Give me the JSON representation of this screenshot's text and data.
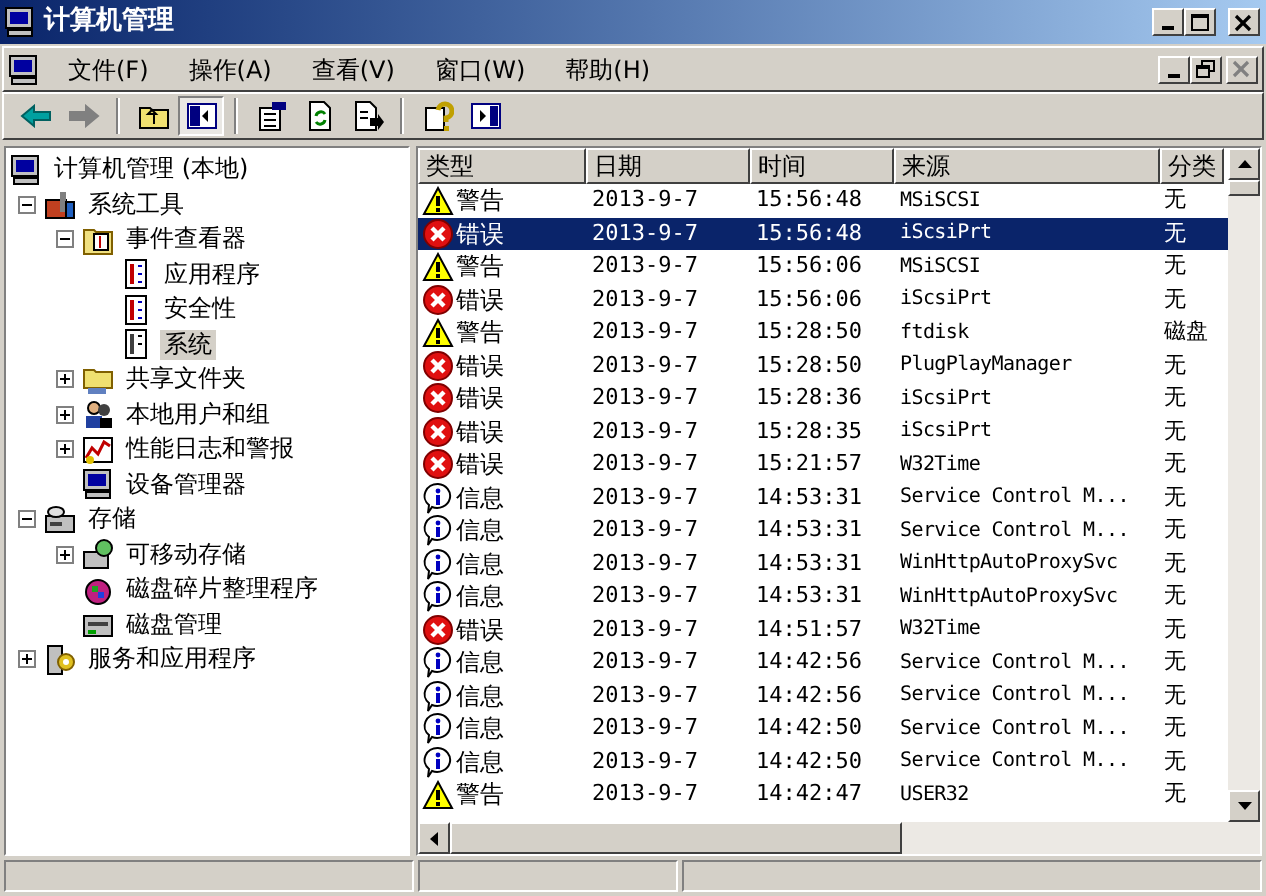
{
  "window": {
    "title": "计算机管理"
  },
  "menu": [
    "文件(F)",
    "操作(A)",
    "查看(V)",
    "窗口(W)",
    "帮助(H)"
  ],
  "toolbar": [
    {
      "kind": "back",
      "disabled": false
    },
    {
      "kind": "forward",
      "disabled": true
    },
    {
      "kind": "separator"
    },
    {
      "kind": "up"
    },
    {
      "kind": "tree",
      "pressed": true
    },
    {
      "kind": "separator"
    },
    {
      "kind": "properties"
    },
    {
      "kind": "refresh"
    },
    {
      "kind": "export"
    },
    {
      "kind": "separator"
    },
    {
      "kind": "help"
    },
    {
      "kind": "pane"
    }
  ],
  "tree": [
    {
      "label": "计算机管理 (本地)",
      "selected": false,
      "children": [
        {
          "label": "系统工具",
          "selected": false,
          "expanded": true,
          "children": [
            {
              "label": "事件查看器",
              "selected": false,
              "expanded": true,
              "children": [
                {
                  "label": "应用程序",
                  "selected": false
                },
                {
                  "label": "安全性",
                  "selected": false
                },
                {
                  "label": "系统",
                  "selected": true
                }
              ]
            },
            {
              "label": "共享文件夹",
              "selected": false,
              "expanded": false
            },
            {
              "label": "本地用户和组",
              "selected": false,
              "expanded": false
            },
            {
              "label": "性能日志和警报",
              "selected": false,
              "expanded": false
            },
            {
              "label": "设备管理器",
              "selected": false
            }
          ]
        },
        {
          "label": "存储",
          "selected": false,
          "expanded": true,
          "children": [
            {
              "label": "可移动存储",
              "selected": false,
              "expanded": false
            },
            {
              "label": "磁盘碎片整理程序",
              "selected": false
            },
            {
              "label": "磁盘管理",
              "selected": false
            }
          ]
        },
        {
          "label": "服务和应用程序",
          "selected": false,
          "expanded": false
        }
      ]
    }
  ],
  "table": {
    "columns": [
      "类型",
      "日期",
      "时间",
      "来源",
      "分类"
    ],
    "rows": [
      {
        "kind": "warning",
        "type": "警告",
        "date": "2013-9-7",
        "time": "15:56:48",
        "source": "MSiSCSI",
        "category": "无",
        "selected": false
      },
      {
        "kind": "error",
        "type": "错误",
        "date": "2013-9-7",
        "time": "15:56:48",
        "source": "iScsiPrt",
        "category": "无",
        "selected": true
      },
      {
        "kind": "warning",
        "type": "警告",
        "date": "2013-9-7",
        "time": "15:56:06",
        "source": "MSiSCSI",
        "category": "无",
        "selected": false
      },
      {
        "kind": "error",
        "type": "错误",
        "date": "2013-9-7",
        "time": "15:56:06",
        "source": "iScsiPrt",
        "category": "无",
        "selected": false
      },
      {
        "kind": "warning",
        "type": "警告",
        "date": "2013-9-7",
        "time": "15:28:50",
        "source": "ftdisk",
        "category": "磁盘",
        "selected": false
      },
      {
        "kind": "error",
        "type": "错误",
        "date": "2013-9-7",
        "time": "15:28:50",
        "source": "PlugPlayManager",
        "category": "无",
        "selected": false
      },
      {
        "kind": "error",
        "type": "错误",
        "date": "2013-9-7",
        "time": "15:28:36",
        "source": "iScsiPrt",
        "category": "无",
        "selected": false
      },
      {
        "kind": "error",
        "type": "错误",
        "date": "2013-9-7",
        "time": "15:28:35",
        "source": "iScsiPrt",
        "category": "无",
        "selected": false
      },
      {
        "kind": "error",
        "type": "错误",
        "date": "2013-9-7",
        "time": "15:21:57",
        "source": "W32Time",
        "category": "无",
        "selected": false
      },
      {
        "kind": "info",
        "type": "信息",
        "date": "2013-9-7",
        "time": "14:53:31",
        "source": "Service Control M...",
        "category": "无",
        "selected": false
      },
      {
        "kind": "info",
        "type": "信息",
        "date": "2013-9-7",
        "time": "14:53:31",
        "source": "Service Control M...",
        "category": "无",
        "selected": false
      },
      {
        "kind": "info",
        "type": "信息",
        "date": "2013-9-7",
        "time": "14:53:31",
        "source": "WinHttpAutoProxySvc",
        "category": "无",
        "selected": false
      },
      {
        "kind": "info",
        "type": "信息",
        "date": "2013-9-7",
        "time": "14:53:31",
        "source": "WinHttpAutoProxySvc",
        "category": "无",
        "selected": false
      },
      {
        "kind": "error",
        "type": "错误",
        "date": "2013-9-7",
        "time": "14:51:57",
        "source": "W32Time",
        "category": "无",
        "selected": false
      },
      {
        "kind": "info",
        "type": "信息",
        "date": "2013-9-7",
        "time": "14:42:56",
        "source": "Service Control M...",
        "category": "无",
        "selected": false
      },
      {
        "kind": "info",
        "type": "信息",
        "date": "2013-9-7",
        "time": "14:42:56",
        "source": "Service Control M...",
        "category": "无",
        "selected": false
      },
      {
        "kind": "info",
        "type": "信息",
        "date": "2013-9-7",
        "time": "14:42:50",
        "source": "Service Control M...",
        "category": "无",
        "selected": false
      },
      {
        "kind": "info",
        "type": "信息",
        "date": "2013-9-7",
        "time": "14:42:50",
        "source": "Service Control M...",
        "category": "无",
        "selected": false
      },
      {
        "kind": "warning",
        "type": "警告",
        "date": "2013-9-7",
        "time": "14:42:47",
        "source": "USER32",
        "category": "无",
        "selected": false
      }
    ]
  }
}
